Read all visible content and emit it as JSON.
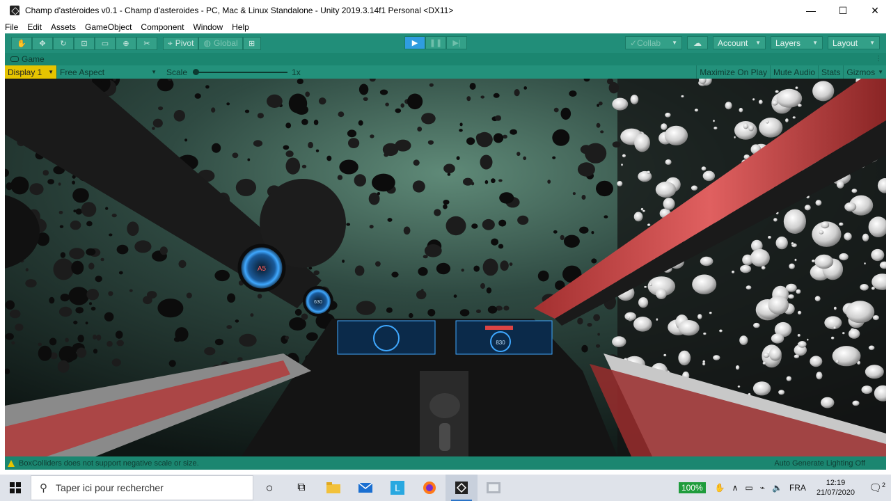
{
  "window": {
    "title": "Champ d'astéroides v0.1 - Champ d'asteroides - PC, Mac & Linux Standalone - Unity 2019.3.14f1 Personal <DX11>",
    "controls": {
      "minimize": "—",
      "maximize": "☐",
      "close": "✕"
    }
  },
  "menubar": {
    "items": [
      "File",
      "Edit",
      "Assets",
      "GameObject",
      "Component",
      "Window",
      "Help"
    ]
  },
  "toolbar": {
    "pivot_label": "Pivot",
    "global_label": "Global",
    "collab_label": "Collab",
    "account_label": "Account",
    "layers_label": "Layers",
    "layout_label": "Layout"
  },
  "game_tab": {
    "label": "Game"
  },
  "game_toolbar": {
    "display": "Display 1",
    "aspect": "Free Aspect",
    "scale_label": "Scale",
    "scale_value": "1x",
    "maximize_on_play": "Maximize On Play",
    "mute_audio": "Mute Audio",
    "stats": "Stats",
    "gizmos": "Gizmos"
  },
  "status": {
    "warning": "BoxColliders does not support negative scale or size.",
    "lighting": "Auto Generate Lighting Off"
  },
  "taskbar": {
    "search_placeholder": "Taper ici pour rechercher",
    "battery": "100%",
    "language": "FRA",
    "time": "12:19",
    "date": "21/07/2020",
    "notification_count": "2"
  },
  "game_view": {
    "hud_gauge_left": "A5",
    "hud_gauge_small": "630",
    "hud_speed": "830"
  },
  "colors": {
    "unity_teal": "#1e8c78",
    "play_active": "#2f9de0",
    "display_highlight": "#e6c400",
    "battery_green": "#1f9c3c"
  }
}
